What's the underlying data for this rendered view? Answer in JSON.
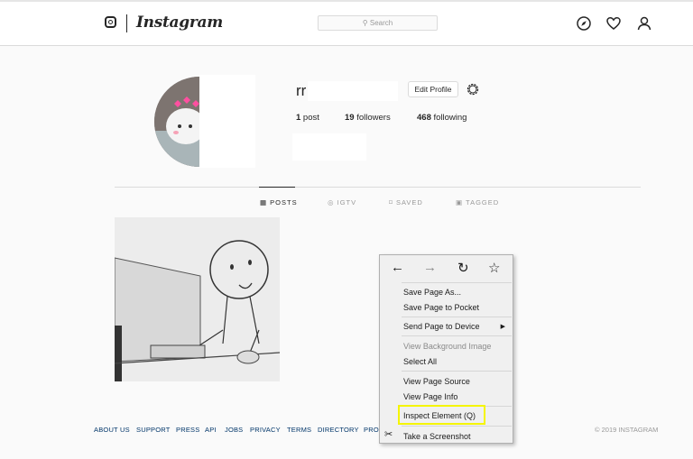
{
  "header": {
    "brand": "Instagram",
    "search_placeholder": "Search",
    "icons": [
      "compass-icon",
      "heart-icon",
      "user-icon"
    ]
  },
  "profile": {
    "username": "rr",
    "edit_label": "Edit Profile",
    "posts_count": "1",
    "posts_label": " post",
    "followers_count": "19",
    "followers_label": " followers",
    "following_count": "468",
    "following_label": " following"
  },
  "tabs": [
    {
      "label": "POSTS",
      "icon": "grid-icon",
      "active": true
    },
    {
      "label": "IGTV",
      "icon": "igtv-icon",
      "active": false
    },
    {
      "label": "SAVED",
      "icon": "bookmark-icon",
      "active": false
    },
    {
      "label": "TAGGED",
      "icon": "tag-icon",
      "active": false
    }
  ],
  "footer": {
    "links": [
      "ABOUT US",
      "SUPPORT",
      "PRESS",
      "API",
      "JOBS",
      "PRIVACY",
      "TERMS",
      "DIRECTORY",
      "PRO"
    ],
    "copyright": "© 2019 INSTAGRAM"
  },
  "context_menu": {
    "nav_icons": [
      "back-icon",
      "forward-icon",
      "reload-icon",
      "bookmark-star-icon"
    ],
    "items": [
      "Save Page As...",
      "Save Page to Pocket",
      "Send Page to Device",
      "View Background Image",
      "Select All",
      "View Page Source",
      "View Page Info",
      "Inspect Element (Q)",
      "Take a Screenshot"
    ],
    "highlight_color": "#f5f500"
  }
}
